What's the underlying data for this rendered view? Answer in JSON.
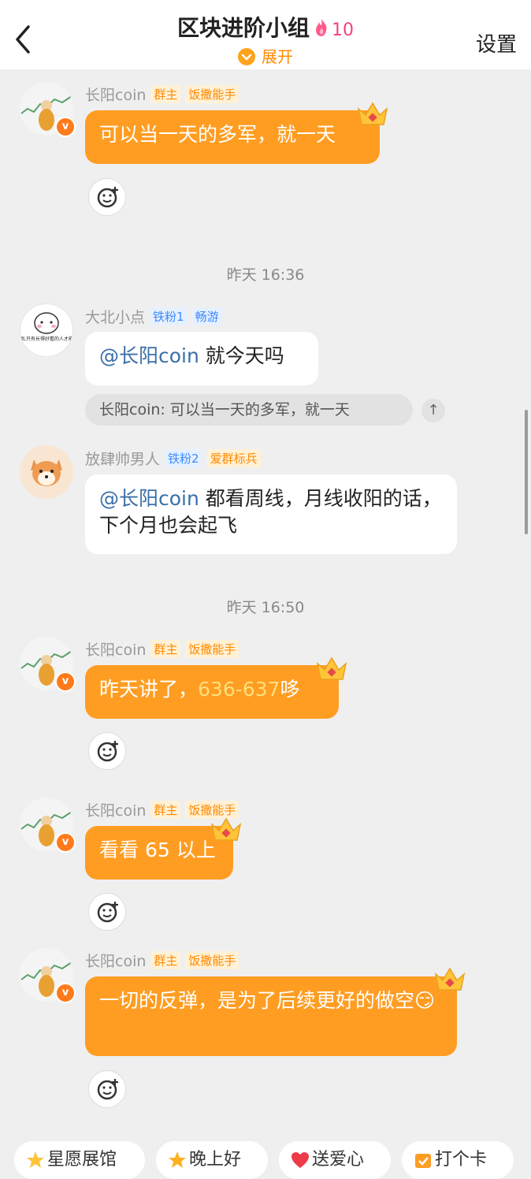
{
  "header": {
    "title": "区块进阶小组",
    "member_count": "10",
    "expand_label": "展开",
    "settings_label": "设置"
  },
  "messages": [
    {
      "sender": "长阳coin",
      "tag1": "群主",
      "tag2": "饭撒能手",
      "text": "可以当一天的多军，就一天"
    },
    {
      "time": "昨天 16:36"
    },
    {
      "sender": "大北小点",
      "tag1": "铁粉1",
      "tag2": "畅游",
      "mention": "@长阳coin",
      "text": " 就今天吗"
    },
    {
      "quote": "长阳coin: 可以当一天的多军，就一天"
    },
    {
      "sender": "放肆帅男人",
      "tag1": "铁粉2",
      "tag2": "爱群标兵",
      "mention": "@长阳coin",
      "text": " 都看周线，月线收阳的话，下个月也会起飞"
    },
    {
      "time": "昨天 16:50"
    },
    {
      "sender": "长阳coin",
      "tag1": "群主",
      "tag2": "饭撒能手",
      "text_pre": "昨天讲了，",
      "highlight": "636-637",
      "text_post": "哆"
    },
    {
      "sender": "长阳coin",
      "tag1": "群主",
      "tag2": "饭撒能手",
      "text": "看看 65 以上"
    },
    {
      "sender": "长阳coin",
      "tag1": "群主",
      "tag2": "饭撒能手",
      "text": "一切的反弹，是为了后续更好的做空😏"
    }
  ],
  "avatar_caption": "这张图,只有长得好看的人才能看见",
  "quick_chips": [
    "星愿展馆",
    "晚上好",
    "送爱心",
    "打个卡"
  ],
  "colors": {
    "accent": "#ff9d22",
    "mention": "#3b6fa8",
    "count": "#f0457a"
  }
}
